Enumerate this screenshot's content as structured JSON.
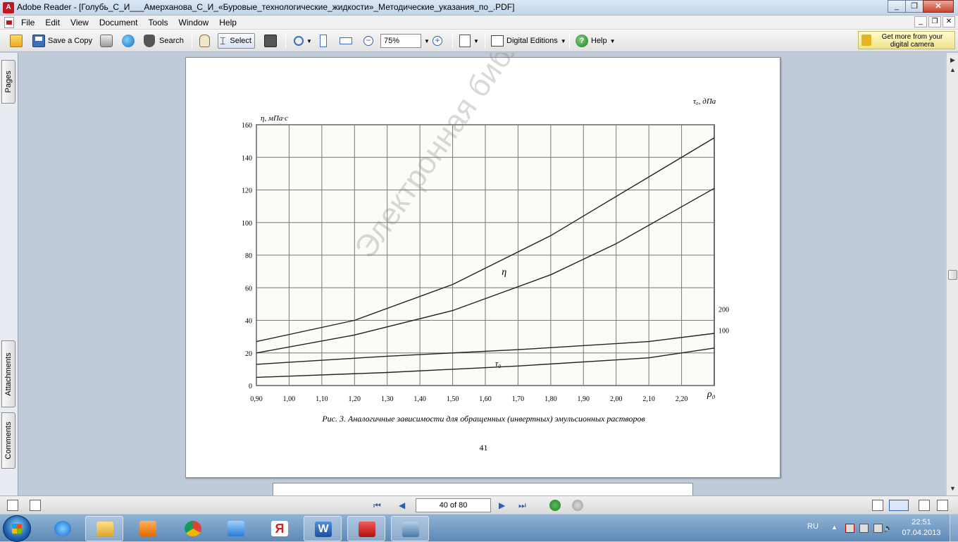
{
  "window": {
    "title": "Adobe Reader - [Голубь_С_И___Амерханова_С_И_«Буровые_технологические_жидкости»_Методические_указания_по_.PDF]"
  },
  "menu": [
    "File",
    "Edit",
    "View",
    "Document",
    "Tools",
    "Window",
    "Help"
  ],
  "toolbar": {
    "save_copy": "Save a Copy",
    "search": "Search",
    "select": "Select",
    "zoom": "75%",
    "digital_editions": "Digital Editions",
    "help": "Help"
  },
  "ad": {
    "line1": "Get more from your",
    "line2": "digital camera"
  },
  "side_tabs": [
    "Pages",
    "Attachments",
    "Comments"
  ],
  "page": {
    "caption": "Рис. 3. Аналогичные зависимости для обращенных (инвертных) эмульсионных растворов",
    "number": "41",
    "watermark": "Электронная библиотека АГНИ"
  },
  "chart_data": {
    "type": "line",
    "ylabel": "η, мПа·с",
    "y2label": "τ₀, дПа",
    "xlabel": "ρ₀",
    "x_ticks": [
      "0,90",
      "1,00",
      "1,10",
      "1,20",
      "1,30",
      "1,40",
      "1,50",
      "1,60",
      "1,70",
      "1,80",
      "1,90",
      "2,00",
      "2,10",
      "2,20"
    ],
    "y_ticks": [
      "0",
      "20",
      "40",
      "60",
      "80",
      "100",
      "120",
      "140",
      "160"
    ],
    "y2_ticks": [
      "100",
      "200"
    ],
    "xlim": [
      0.9,
      2.3
    ],
    "ylim": [
      0,
      160
    ],
    "grid": true,
    "curve_labels": [
      "η",
      "τ₀"
    ],
    "series": [
      {
        "x": [
          0.9,
          1.2,
          1.5,
          1.8,
          2.1,
          2.3
        ],
        "values": [
          27,
          40,
          62,
          92,
          128,
          152
        ]
      },
      {
        "x": [
          0.9,
          1.2,
          1.5,
          1.8,
          2.0,
          2.3
        ],
        "values": [
          20,
          31,
          46,
          68,
          87,
          121
        ]
      },
      {
        "x": [
          0.9,
          1.3,
          1.7,
          2.1,
          2.3
        ],
        "values": [
          13,
          18,
          22,
          27,
          32
        ]
      },
      {
        "x": [
          0.9,
          1.3,
          1.7,
          2.1,
          2.3
        ],
        "values": [
          5,
          8,
          12,
          17,
          23
        ]
      }
    ]
  },
  "statusbar": {
    "page_field": "40 of 80"
  },
  "tray": {
    "lang": "RU",
    "time": "22:51",
    "date": "07.04.2013"
  }
}
